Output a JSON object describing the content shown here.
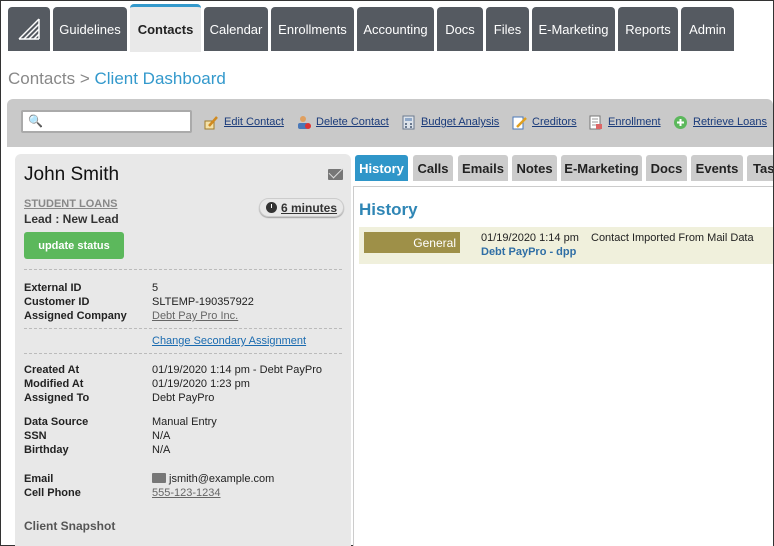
{
  "nav": {
    "logo": "logo-icon",
    "tabs": [
      "Guidelines",
      "Contacts",
      "Calendar",
      "Enrollments",
      "Accounting",
      "Docs",
      "Files",
      "E-Marketing",
      "Reports",
      "Admin"
    ],
    "active": "Contacts"
  },
  "header": {
    "root": "Contacts",
    "separator": ">",
    "current": "Client Dashboard"
  },
  "toolbar": {
    "search_placeholder": "",
    "actions": [
      "Edit Contact",
      "Delete Contact",
      "Budget Analysis",
      "Creditors",
      "Enrollment",
      "Retrieve Loans"
    ]
  },
  "contact": {
    "name": "John Smith",
    "campaign": "STUDENT LOANS",
    "lead_status": "Lead : New Lead",
    "timer": "6 minutes",
    "update_button": "update status",
    "fields": {
      "external_id": {
        "label": "External ID",
        "value": "5"
      },
      "customer_id": {
        "label": "Customer ID",
        "value": "SLTEMP-190357922"
      },
      "assigned_company": {
        "label": "Assigned Company",
        "value": "Debt Pay Pro Inc."
      },
      "secondary_link": "Change Secondary Assignment",
      "created_at": {
        "label": "Created At",
        "value": "01/19/2020 1:14 pm - Debt PayPro"
      },
      "modified_at": {
        "label": "Modified At",
        "value": "01/19/2020 1:23 pm"
      },
      "assigned_to": {
        "label": "Assigned To",
        "value": "Debt PayPro"
      },
      "data_source": {
        "label": "Data Source",
        "value": "Manual Entry"
      },
      "ssn": {
        "label": "SSN",
        "value": "N/A"
      },
      "birthday": {
        "label": "Birthday",
        "value": "N/A"
      },
      "email": {
        "label": "Email",
        "value": "jsmith@example.com"
      },
      "cell_phone": {
        "label": "Cell Phone",
        "value": "555-123-1234"
      }
    },
    "snapshot_label": "Client Snapshot"
  },
  "right": {
    "tabs": [
      "History",
      "Calls",
      "Emails",
      "Notes",
      "E-Marketing",
      "Docs",
      "Events",
      "Tasks"
    ],
    "active": "History",
    "history_title": "History",
    "entries": [
      {
        "category": "General",
        "date": "01/19/2020 1:14 pm",
        "description": "Contact Imported From Mail Data",
        "user": "Debt PayPro - dpp"
      }
    ]
  },
  "colors": {
    "nav_bg": "#555a61",
    "accent": "#3399cc",
    "update_green": "#5cb85c",
    "category_olive": "#9e9048"
  }
}
